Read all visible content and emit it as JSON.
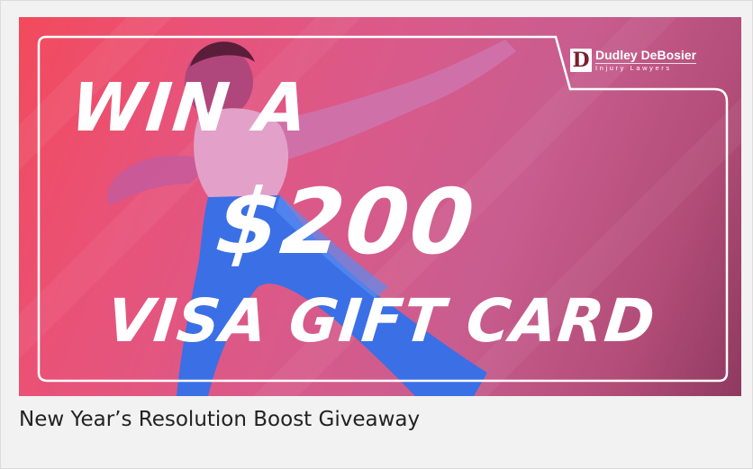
{
  "banner": {
    "headline_line1": "WIN A",
    "headline_line2": "$200",
    "headline_line3": "VISA GIFT CARD",
    "logo": {
      "mark": "D",
      "name": "Dudley DeBosier",
      "tagline": "Injury Lawyers"
    },
    "colors": {
      "gradient_start": "#f24a5c",
      "gradient_end": "#8f3a60",
      "text": "#ffffff",
      "figure": "#3a6fe6"
    }
  },
  "caption": {
    "title": "New Year’s Resolution Boost Giveaway"
  }
}
